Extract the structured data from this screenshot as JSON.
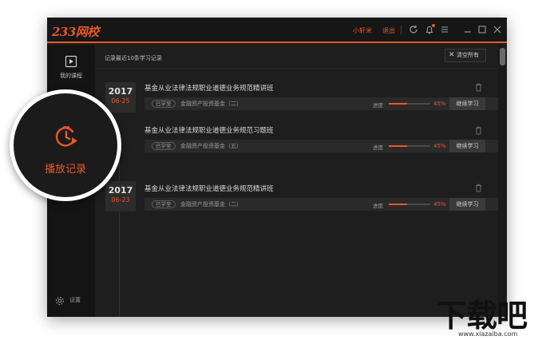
{
  "titlebar": {
    "logo": "233网校",
    "user": "小轩米",
    "logout": "退出",
    "icons": [
      "refresh-icon",
      "bell-icon",
      "menu-icon",
      "minimize-icon",
      "maximize-icon",
      "close-icon"
    ]
  },
  "sidebar": {
    "my_courses": "我的课程",
    "play_history": "播放记录",
    "settings": "设置"
  },
  "main": {
    "summary": "记录最近10条学习记录",
    "clear_all": "清空所有",
    "groups": [
      {
        "year": "2017",
        "month_day": "06-25",
        "records": [
          {
            "title": "基金从业法律法规职业道德业务规范精讲班",
            "tag": "已学至",
            "fund": "金融资产投资基金（二）",
            "progress_label": "进度",
            "progress": 45,
            "progress_text": "45%",
            "button": "继续学习"
          },
          {
            "title": "基金从业法律法规职业道德业务规范习题班",
            "tag": "已学至",
            "fund": "金融资产投资基金（五）",
            "progress_label": "进度",
            "progress": 45,
            "progress_text": "45%",
            "button": "继续学习"
          }
        ]
      },
      {
        "year": "2017",
        "month_day": "06-23",
        "records": [
          {
            "title": "基金从业法律法规职业道德业务规范精讲班",
            "tag": "已学至",
            "fund": "金融资产投资基金（二）",
            "progress_label": "进度",
            "progress": 45,
            "progress_text": "45%",
            "button": "继续学习"
          }
        ]
      }
    ]
  },
  "watermark": {
    "text": "下载吧",
    "url": "www.xiazaiba.com"
  },
  "colors": {
    "accent": "#e8582a",
    "background": "#1e1e1e"
  }
}
